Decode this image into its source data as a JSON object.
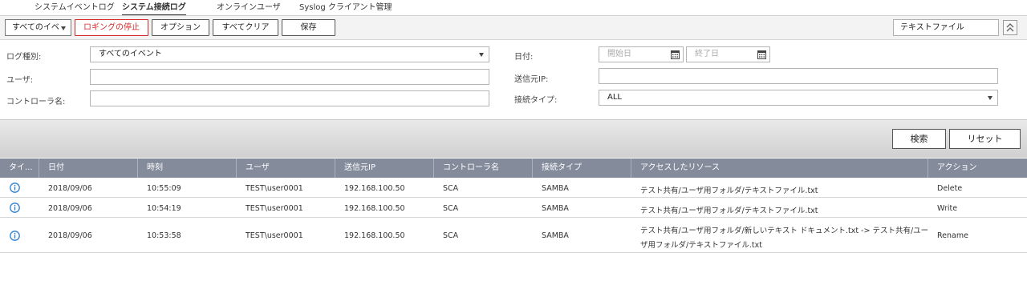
{
  "tabs": [
    {
      "label": "システムイベントログ",
      "active": false
    },
    {
      "label": "システム接続ログ",
      "active": true
    },
    {
      "label": "オンラインユーザ",
      "active": false
    },
    {
      "label": "Syslog クライアント管理",
      "active": false
    }
  ],
  "toolbar": {
    "event_filter": "すべてのイベ",
    "stop_logging": "ロギングの停止",
    "options": "オプション",
    "clear_all": "すべてクリア",
    "save": "保存",
    "export_format": "テキストファイル"
  },
  "filters": {
    "log_type_label": "ログ種別:",
    "log_type_value": "すべてのイベント",
    "user_label": "ユーザ:",
    "user_value": "",
    "controller_label": "コントローラ名:",
    "controller_value": "",
    "date_label": "日付:",
    "start_date_placeholder": "開始日",
    "end_date_placeholder": "終了日",
    "source_ip_label": "送信元IP:",
    "source_ip_value": "",
    "conn_type_label": "接続タイプ:",
    "conn_type_value": "ALL"
  },
  "search": {
    "search_label": "検索",
    "reset_label": "リセット"
  },
  "table": {
    "headers": [
      "タイ...",
      "日付",
      "時刻",
      "ユーザ",
      "送信元IP",
      "コントローラ名",
      "接続タイプ",
      "アクセスしたリソース",
      "アクション"
    ],
    "rows": [
      {
        "date": "2018/09/06",
        "time": "10:55:09",
        "user": "TEST\\user0001",
        "ip": "192.168.100.50",
        "controller": "SCA",
        "conn": "SAMBA",
        "resource_1": "テスト共有/ユーザ用フォルダ/テキストファイル.txt",
        "resource_2": "",
        "action": "Delete"
      },
      {
        "date": "2018/09/06",
        "time": "10:54:19",
        "user": "TEST\\user0001",
        "ip": "192.168.100.50",
        "controller": "SCA",
        "conn": "SAMBA",
        "resource_1": "テスト共有/ユーザ用フォルダ/テキストファイル.txt",
        "resource_2": "",
        "action": "Write"
      },
      {
        "date": "2018/09/06",
        "time": "10:53:58",
        "user": "TEST\\user0001",
        "ip": "192.168.100.50",
        "controller": "SCA",
        "conn": "SAMBA",
        "resource_1": "テスト共有/ユーザ用フォルダ/新しいテキスト ドキュメント.txt -> テスト共有/ユー",
        "resource_2": "ザ用フォルダ/テキストファイル.txt",
        "action": "Rename"
      }
    ]
  },
  "colors": {
    "header_bg": "#848c9c",
    "danger": "#d62828",
    "info_icon": "#2a7fd4"
  },
  "icons": [
    "calendar-icon",
    "info-icon",
    "collapse-icon",
    "chevron-down-icon"
  ]
}
